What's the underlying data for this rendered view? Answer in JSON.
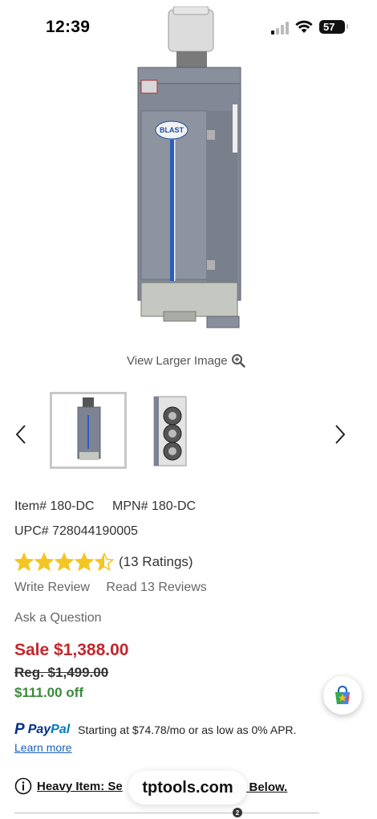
{
  "status_bar": {
    "time": "12:39",
    "battery": "57"
  },
  "product": {
    "image_alt_icon": "dust-collector-image",
    "view_larger_label": "View Larger Image",
    "item_number": "Item# 180-DC",
    "mpn": "MPN# 180-DC",
    "upc": "UPC# 728044190005",
    "rating_value": 4.5,
    "rating_count_label": "(13 Ratings)",
    "write_review_label": "Write Review",
    "read_reviews_label": "Read 13 Reviews",
    "ask_question_label": "Ask a Question",
    "sale_price": "Sale $1,388.00",
    "regular_price": "Reg. $1,499.00",
    "savings": "$111.00 off"
  },
  "paypal": {
    "brand_pay": "Pay",
    "brand_pal": "Pal",
    "financing_text": "Starting at $74.78/mo or as low as 0% APR.",
    "learn_more_label": "Learn more"
  },
  "notice": {
    "left_text": "Heavy Item: Se",
    "right_text": "rge Below."
  },
  "browser": {
    "url_label": "tptools.com"
  },
  "colors": {
    "sale_red": "#c1272d",
    "savings_green": "#3b8a3b",
    "star_gold": "#f3c623",
    "link_blue": "#1a5fb4"
  }
}
